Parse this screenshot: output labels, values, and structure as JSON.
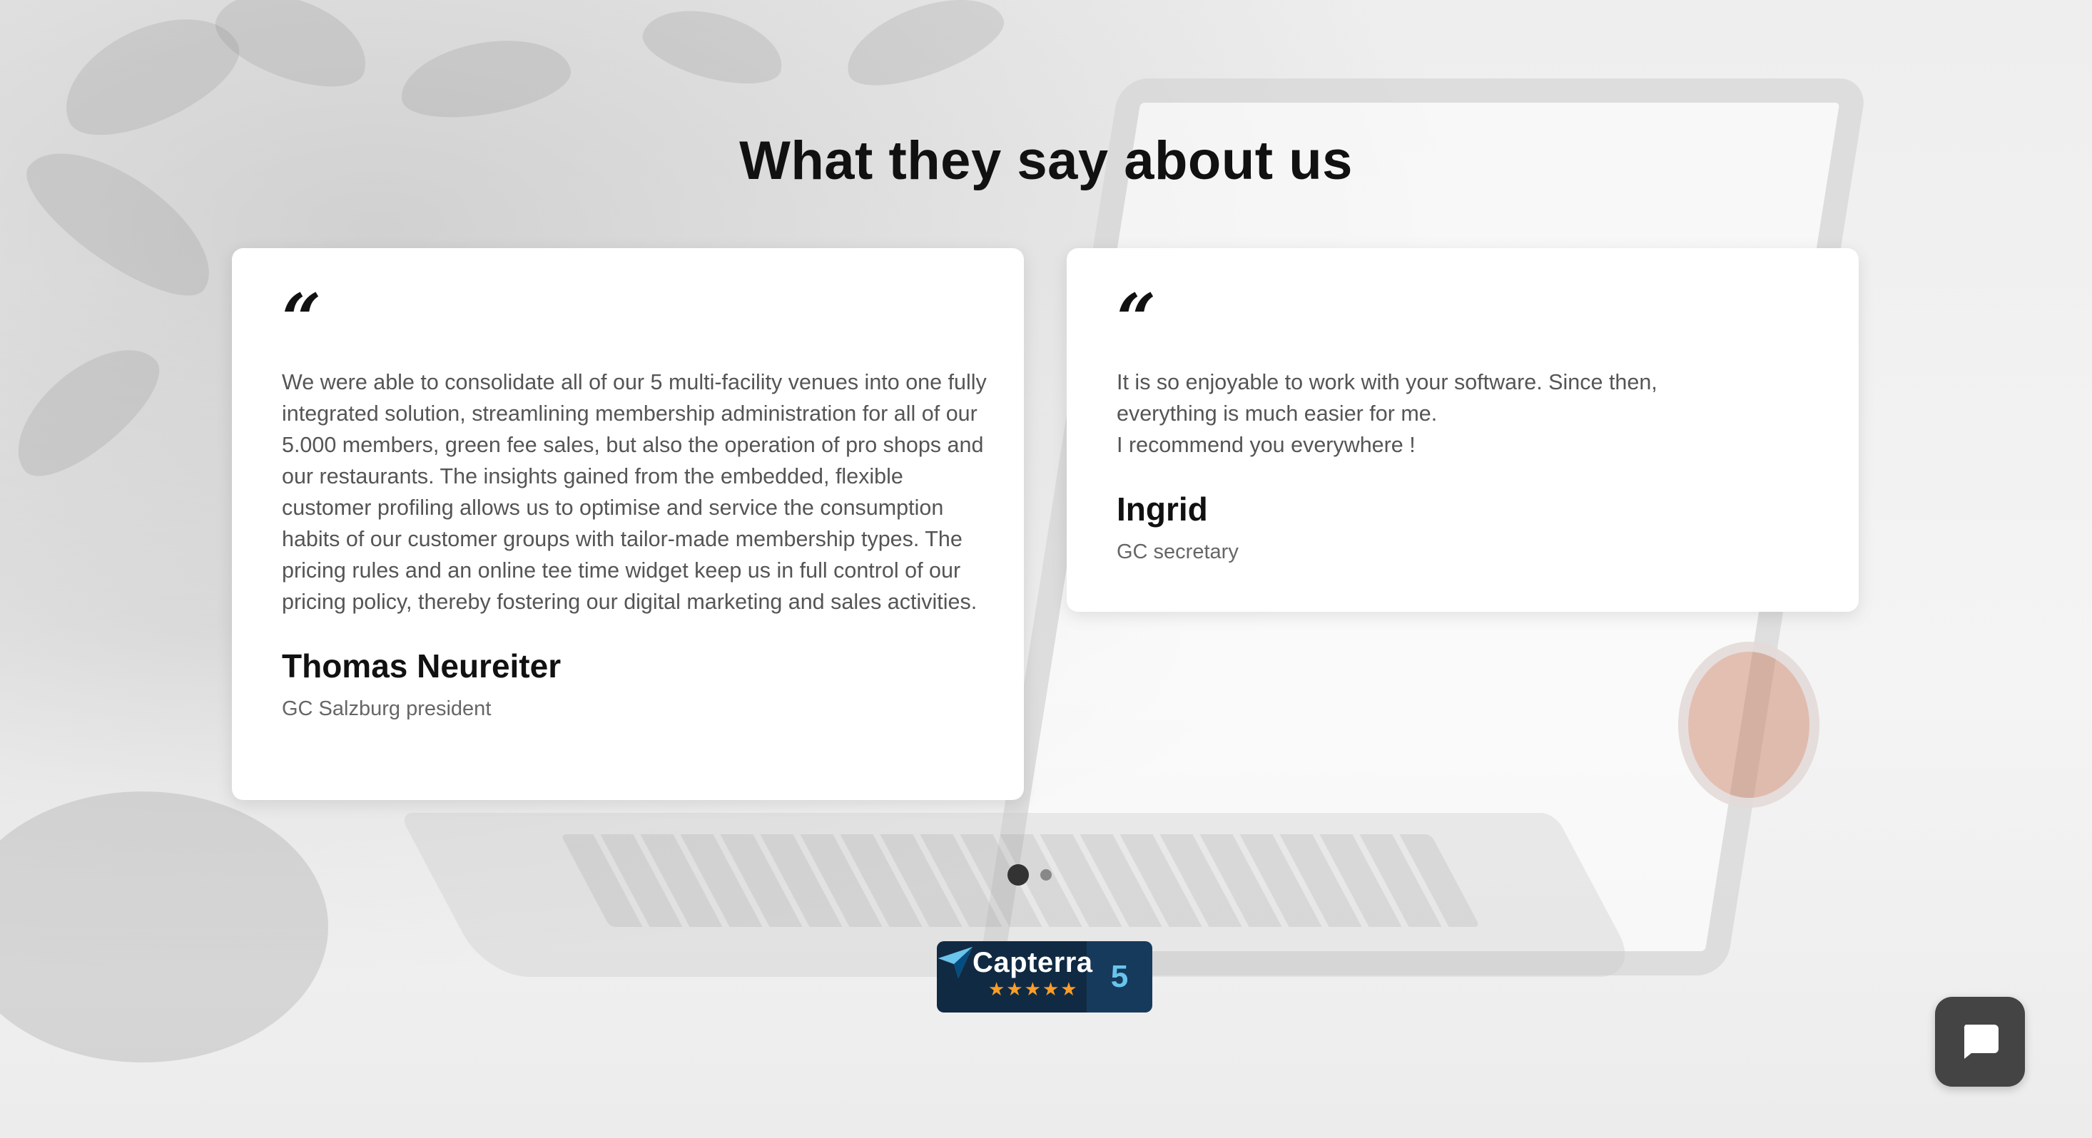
{
  "section": {
    "title": "What they say about us"
  },
  "testimonials": [
    {
      "quote_mark": "“",
      "text": "We were able to consolidate all of our 5 multi-facility venues into one fully integrated solution, streamlining membership administration for all of our 5.000 members, green fee sales, but also the operation of pro shops and our restaurants. The insights gained from the embedded, flexible customer profiling allows us to optimise and service the consumption habits of our customer groups with tailor-made membership types. The pricing rules and an online tee time widget keep us in full control of our pricing policy, thereby fostering our digital marketing and sales activities.",
      "author": "Thomas Neureiter",
      "role": "GC Salzburg president"
    },
    {
      "quote_mark": "“",
      "text": "It is so enjoyable to work with your software. Since then,\neverything is much easier for me.\nI recommend you everywhere !",
      "author": "Ingrid",
      "role": "GC secretary"
    }
  ],
  "carousel": {
    "active_index": 0,
    "count": 2
  },
  "capterra_badge": {
    "name": "Capterra",
    "stars": "★★★★★",
    "score": "5",
    "colors": {
      "background": "#102a43",
      "score_background": "#163a5c",
      "stars": "#ff9d28",
      "score_text": "#68c5ed"
    }
  },
  "chat": {
    "icon": "chat-bubble-icon",
    "color": "#444444"
  }
}
